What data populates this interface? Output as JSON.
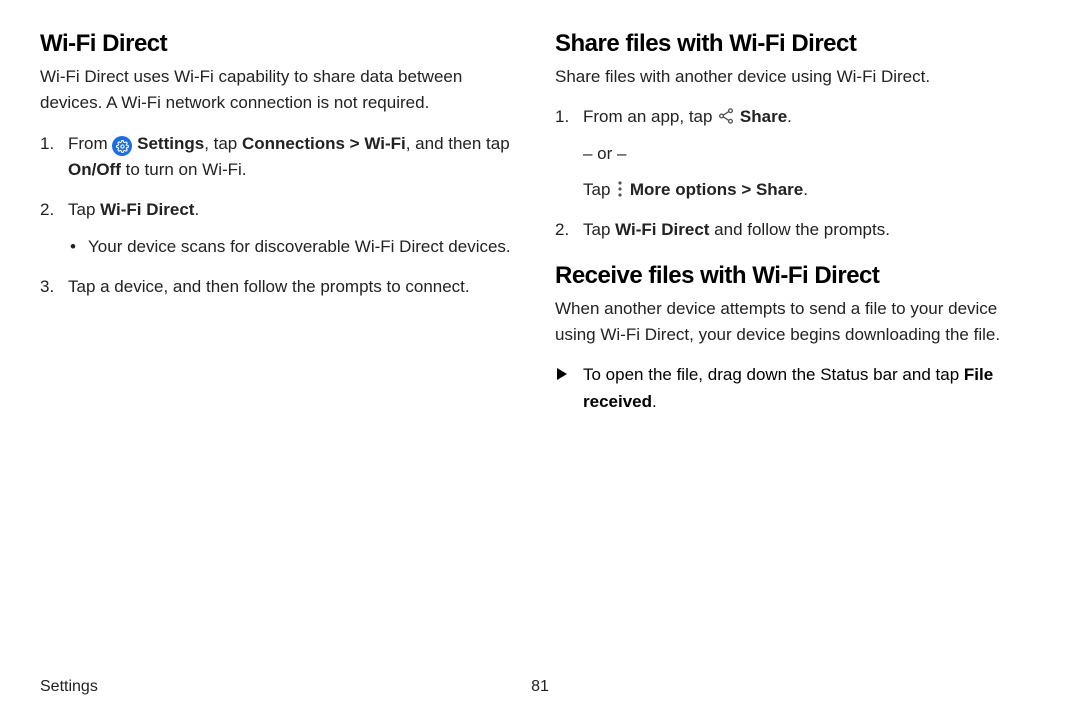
{
  "left": {
    "h": "Wi-Fi Direct",
    "intro": "Wi-Fi Direct uses Wi-Fi capability to share data between devices. A Wi-Fi network connection is not required.",
    "from": "From ",
    "settings": "Settings",
    "tap_conn_pre": ", tap ",
    "connections": "Connections",
    "gt": " > ",
    "wifi": "Wi-Fi",
    "and_then": ", and then tap ",
    "onoff": "On/Off",
    "to_turn": " to turn on Wi-Fi.",
    "tap2_pre": "Tap ",
    "wfd": "Wi-Fi Direct",
    "tap2_post": ".",
    "sub_bullet": "Your device scans for discoverable Wi-Fi Direct devices.",
    "step3": "Tap a device, and then follow the prompts to connect."
  },
  "right": {
    "h1": "Share files with Wi-Fi Direct",
    "intro1": "Share files with another device using Wi-Fi Direct.",
    "s1_pre": "From an app, tap ",
    "share": "Share",
    "s1_post": ".",
    "or": "– or –",
    "tap_pre": "Tap ",
    "moreopts": "More options",
    "gt": " > ",
    "share2": "Share",
    "tap_post": ".",
    "s2_pre": "Tap ",
    "wfd": "Wi-Fi Direct",
    "s2_post": " and follow the prompts.",
    "h2": "Receive files with Wi-Fi Direct",
    "intro2": "When another device attempts to send a file to your device using Wi-Fi Direct, your device begins downloading the file.",
    "tri_pre": "To open the file, drag down the Status bar and tap ",
    "file_rec": "File received",
    "tri_post": "."
  },
  "footer": {
    "section": "Settings",
    "page": "81"
  }
}
